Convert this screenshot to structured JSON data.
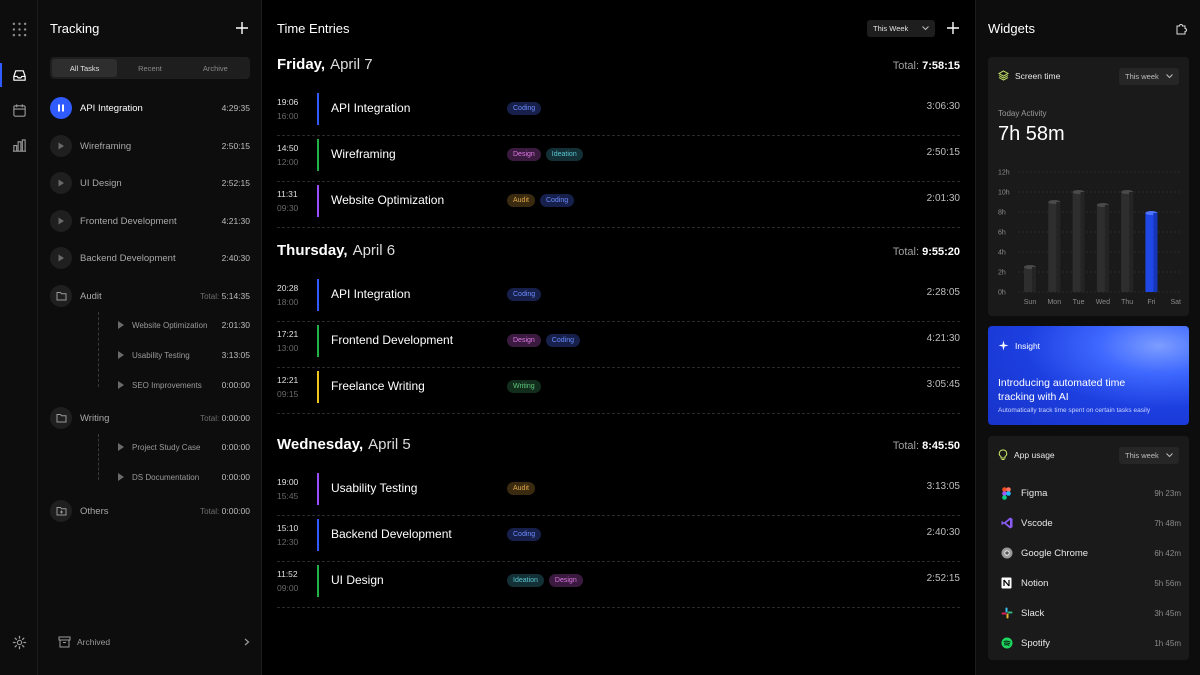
{
  "tracking": {
    "title": "Tracking",
    "tabs": [
      "All Tasks",
      "Recent",
      "Archive"
    ],
    "active_tab": "All Tasks",
    "tasks": [
      {
        "name": "API Integration",
        "time": "4:29:35",
        "running": true
      },
      {
        "name": "Wireframing",
        "time": "2:50:15"
      },
      {
        "name": "UI Design",
        "time": "2:52:15"
      },
      {
        "name": "Frontend Development",
        "time": "4:21:30"
      },
      {
        "name": "Backend Development",
        "time": "2:40:30"
      }
    ],
    "groups": [
      {
        "name": "Audit",
        "total_label": "Total:",
        "total": "5:14:35",
        "items": [
          {
            "name": "Website Optimization",
            "time": "2:01:30"
          },
          {
            "name": "Usability Testing",
            "time": "3:13:05"
          },
          {
            "name": "SEO Improvements",
            "time": "0:00:00"
          }
        ]
      },
      {
        "name": "Writing",
        "total_label": "Total:",
        "total": "0:00:00",
        "items": [
          {
            "name": "Project Study Case",
            "time": "0:00:00"
          },
          {
            "name": "DS Documentation",
            "time": "0:00:00"
          }
        ]
      },
      {
        "name": "Others",
        "total_label": "Total:",
        "total": "0:00:00",
        "items": []
      }
    ],
    "archived_label": "Archived"
  },
  "main": {
    "title": "Time Entries",
    "filter": "This Week",
    "total_label": "Total:",
    "days": [
      {
        "name": "Friday,",
        "date": "April 7",
        "total": "7:58:15",
        "entries": [
          {
            "start": "19:06",
            "end": "16:00",
            "name": "API Integration",
            "color": "#2f5bff",
            "tags": [
              "Coding"
            ],
            "dur": "3:06:30"
          },
          {
            "start": "14:50",
            "end": "12:00",
            "name": "Wireframing",
            "color": "#22b04a",
            "tags": [
              "Design",
              "Ideation"
            ],
            "dur": "2:50:15"
          },
          {
            "start": "11:31",
            "end": "09:30",
            "name": "Website Optimization",
            "color": "#9b4dff",
            "tags": [
              "Audit",
              "Coding"
            ],
            "dur": "2:01:30"
          }
        ]
      },
      {
        "name": "Thursday,",
        "date": "April 6",
        "total": "9:55:20",
        "entries": [
          {
            "start": "20:28",
            "end": "18:00",
            "name": "API Integration",
            "color": "#2f5bff",
            "tags": [
              "Coding"
            ],
            "dur": "2:28:05"
          },
          {
            "start": "17:21",
            "end": "13:00",
            "name": "Frontend Development",
            "color": "#22b04a",
            "tags": [
              "Design",
              "Coding"
            ],
            "dur": "4:21:30"
          },
          {
            "start": "12:21",
            "end": "09:15",
            "name": "Freelance Writing",
            "color": "#f0c419",
            "tags": [
              "Writing"
            ],
            "dur": "3:05:45"
          }
        ]
      },
      {
        "name": "Wednesday,",
        "date": "April 5",
        "total": "8:45:50",
        "entries": [
          {
            "start": "19:00",
            "end": "15:45",
            "name": "Usability Testing",
            "color": "#9b4dff",
            "tags": [
              "Audit"
            ],
            "dur": "3:13:05"
          },
          {
            "start": "15:10",
            "end": "12:30",
            "name": "Backend Development",
            "color": "#2f5bff",
            "tags": [
              "Coding"
            ],
            "dur": "2:40:30"
          },
          {
            "start": "11:52",
            "end": "09:00",
            "name": "UI Design",
            "color": "#22b04a",
            "tags": [
              "Ideation",
              "Design"
            ],
            "dur": "2:52:15"
          }
        ]
      }
    ]
  },
  "tag_colors": {
    "Coding": {
      "bg": "#16204a",
      "fg": "#6f8cff"
    },
    "Design": {
      "bg": "#3a1a3e",
      "fg": "#e07ae8"
    },
    "Ideation": {
      "bg": "#123036",
      "fg": "#5ec8d2"
    },
    "Audit": {
      "bg": "#3a2a10",
      "fg": "#e0a84a"
    },
    "Writing": {
      "bg": "#132d1c",
      "fg": "#5cc47a"
    }
  },
  "widgets": {
    "title": "Widgets",
    "screen_time": {
      "title": "Screen time",
      "filter": "This week",
      "today_label": "Today Activity",
      "today_value": "7h 58m"
    },
    "insight": {
      "label": "Insight",
      "headline": "Introducing automated time tracking with AI",
      "sub": "Automatically track time spent on certain tasks easily"
    },
    "app_usage": {
      "title": "App usage",
      "filter": "This week",
      "apps": [
        {
          "name": "Figma",
          "time": "9h 23m",
          "icon": "figma-icon"
        },
        {
          "name": "Vscode",
          "time": "7h 48m",
          "icon": "vscode-icon"
        },
        {
          "name": "Google Chrome",
          "time": "6h 42m",
          "icon": "chrome-icon"
        },
        {
          "name": "Notion",
          "time": "5h 56m",
          "icon": "notion-icon"
        },
        {
          "name": "Slack",
          "time": "3h 45m",
          "icon": "slack-icon"
        },
        {
          "name": "Spotify",
          "time": "1h 45m",
          "icon": "spotify-icon"
        }
      ]
    }
  },
  "chart_data": {
    "type": "bar",
    "categories": [
      "Sun",
      "Mon",
      "Tue",
      "Wed",
      "Thu",
      "Fri",
      "Sat"
    ],
    "values": [
      2.5,
      9,
      10,
      8.7,
      10,
      7.9,
      0
    ],
    "highlight": "Fri",
    "yticks": [
      "0h",
      "2h",
      "4h",
      "6h",
      "8h",
      "10h",
      "12h"
    ],
    "ylim": [
      0,
      12
    ],
    "grid": true
  }
}
